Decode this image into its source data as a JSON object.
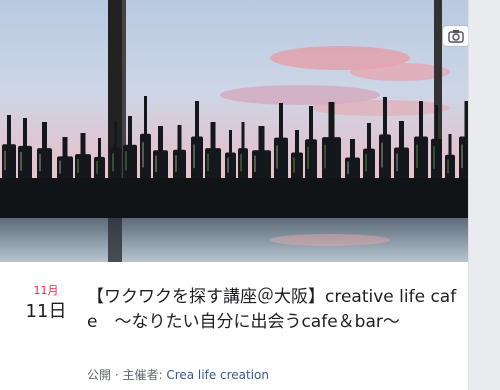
{
  "event": {
    "month": "11月",
    "day": "11日",
    "title": "【ワクワクを探す講座＠大阪】creative life cafe　～なりたい自分に出会うcafe＆bar～",
    "privacy": "公開",
    "separator": " · ",
    "host_prefix": "主催者: ",
    "host_name": "Crea life creation"
  },
  "icons": {
    "cover_action": "camera-icon"
  },
  "colors": {
    "month": "#f02849",
    "host_link": "#385898",
    "meta_text": "#606770",
    "title_text": "#1c1e21"
  }
}
